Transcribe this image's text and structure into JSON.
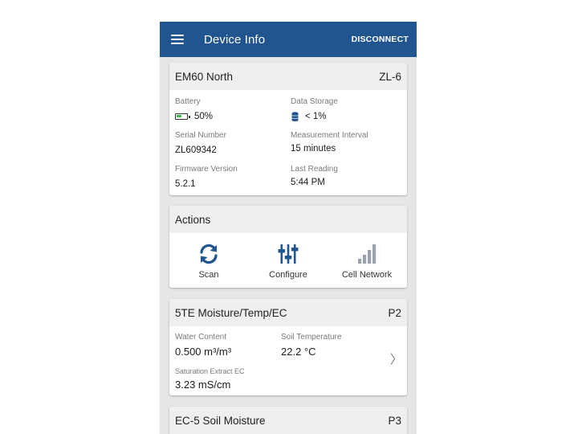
{
  "app_bar": {
    "title": "Device Info",
    "action": "DISCONNECT"
  },
  "device": {
    "name": "EM60 North",
    "code": "ZL-6",
    "battery": {
      "label": "Battery",
      "value": "50%",
      "level": 0.5
    },
    "storage": {
      "label": "Data Storage",
      "value": "< 1%"
    },
    "serial": {
      "label": "Serial Number",
      "value": "ZL609342"
    },
    "interval": {
      "label": "Measurement Interval",
      "value": "15 minutes"
    },
    "firmware": {
      "label": "Firmware Version",
      "value": "5.2.1"
    },
    "last_reading": {
      "label": "Last Reading",
      "value": "5:44 PM"
    }
  },
  "actions": {
    "title": "Actions",
    "items": [
      {
        "label": "Scan",
        "icon": "refresh-icon"
      },
      {
        "label": "Configure",
        "icon": "sliders-icon"
      },
      {
        "label": "Cell Network",
        "icon": "signal-bars-icon"
      }
    ]
  },
  "sensors": [
    {
      "name": "5TE Moisture/Temp/EC",
      "port": "P2",
      "water": {
        "label": "Water Content",
        "value": "0.500 m³/m³"
      },
      "temp": {
        "label": "Soil Temperature",
        "value": "22.2 °C"
      },
      "ec": {
        "label": "Saturation Extract EC",
        "value": "3.23 mS/cm"
      }
    },
    {
      "name": "EC-5 Soil Moisture",
      "port": "P3"
    }
  ],
  "colors": {
    "app_bar": "#20558f",
    "icon_blue": "#20558f",
    "battery_green": "#3bb54a",
    "signal_gray": "#9aa3ad"
  }
}
